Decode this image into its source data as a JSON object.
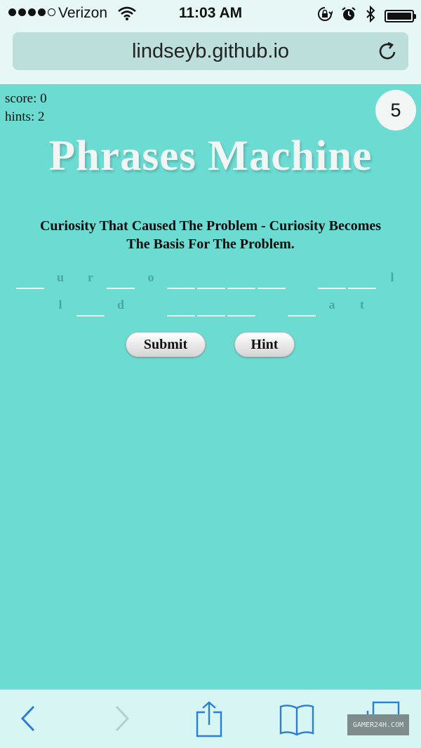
{
  "status_bar": {
    "carrier": "Verizon",
    "time": "11:03 AM"
  },
  "browser": {
    "url": "lindseyb.github.io"
  },
  "game": {
    "score": "score: 0",
    "hints": "hints: 2",
    "timer": "5",
    "title": "Phrases Machine",
    "clue_line1": "Curiosity That Caused The Problem - Curiosity Becomes",
    "clue_line2": "The Basis For The Problem.",
    "row1_letters": [
      "u",
      "r",
      "o",
      "l"
    ],
    "row2_letters": [
      "l",
      "d",
      "a",
      "t"
    ]
  },
  "buttons": {
    "submit": "Submit",
    "hint": "Hint"
  },
  "watermark": "GAMER24H.COM",
  "colors": {
    "page_bg": "#6cdcd3",
    "chrome_bg": "#e6f7f5",
    "tint": "#2a7fd4"
  }
}
